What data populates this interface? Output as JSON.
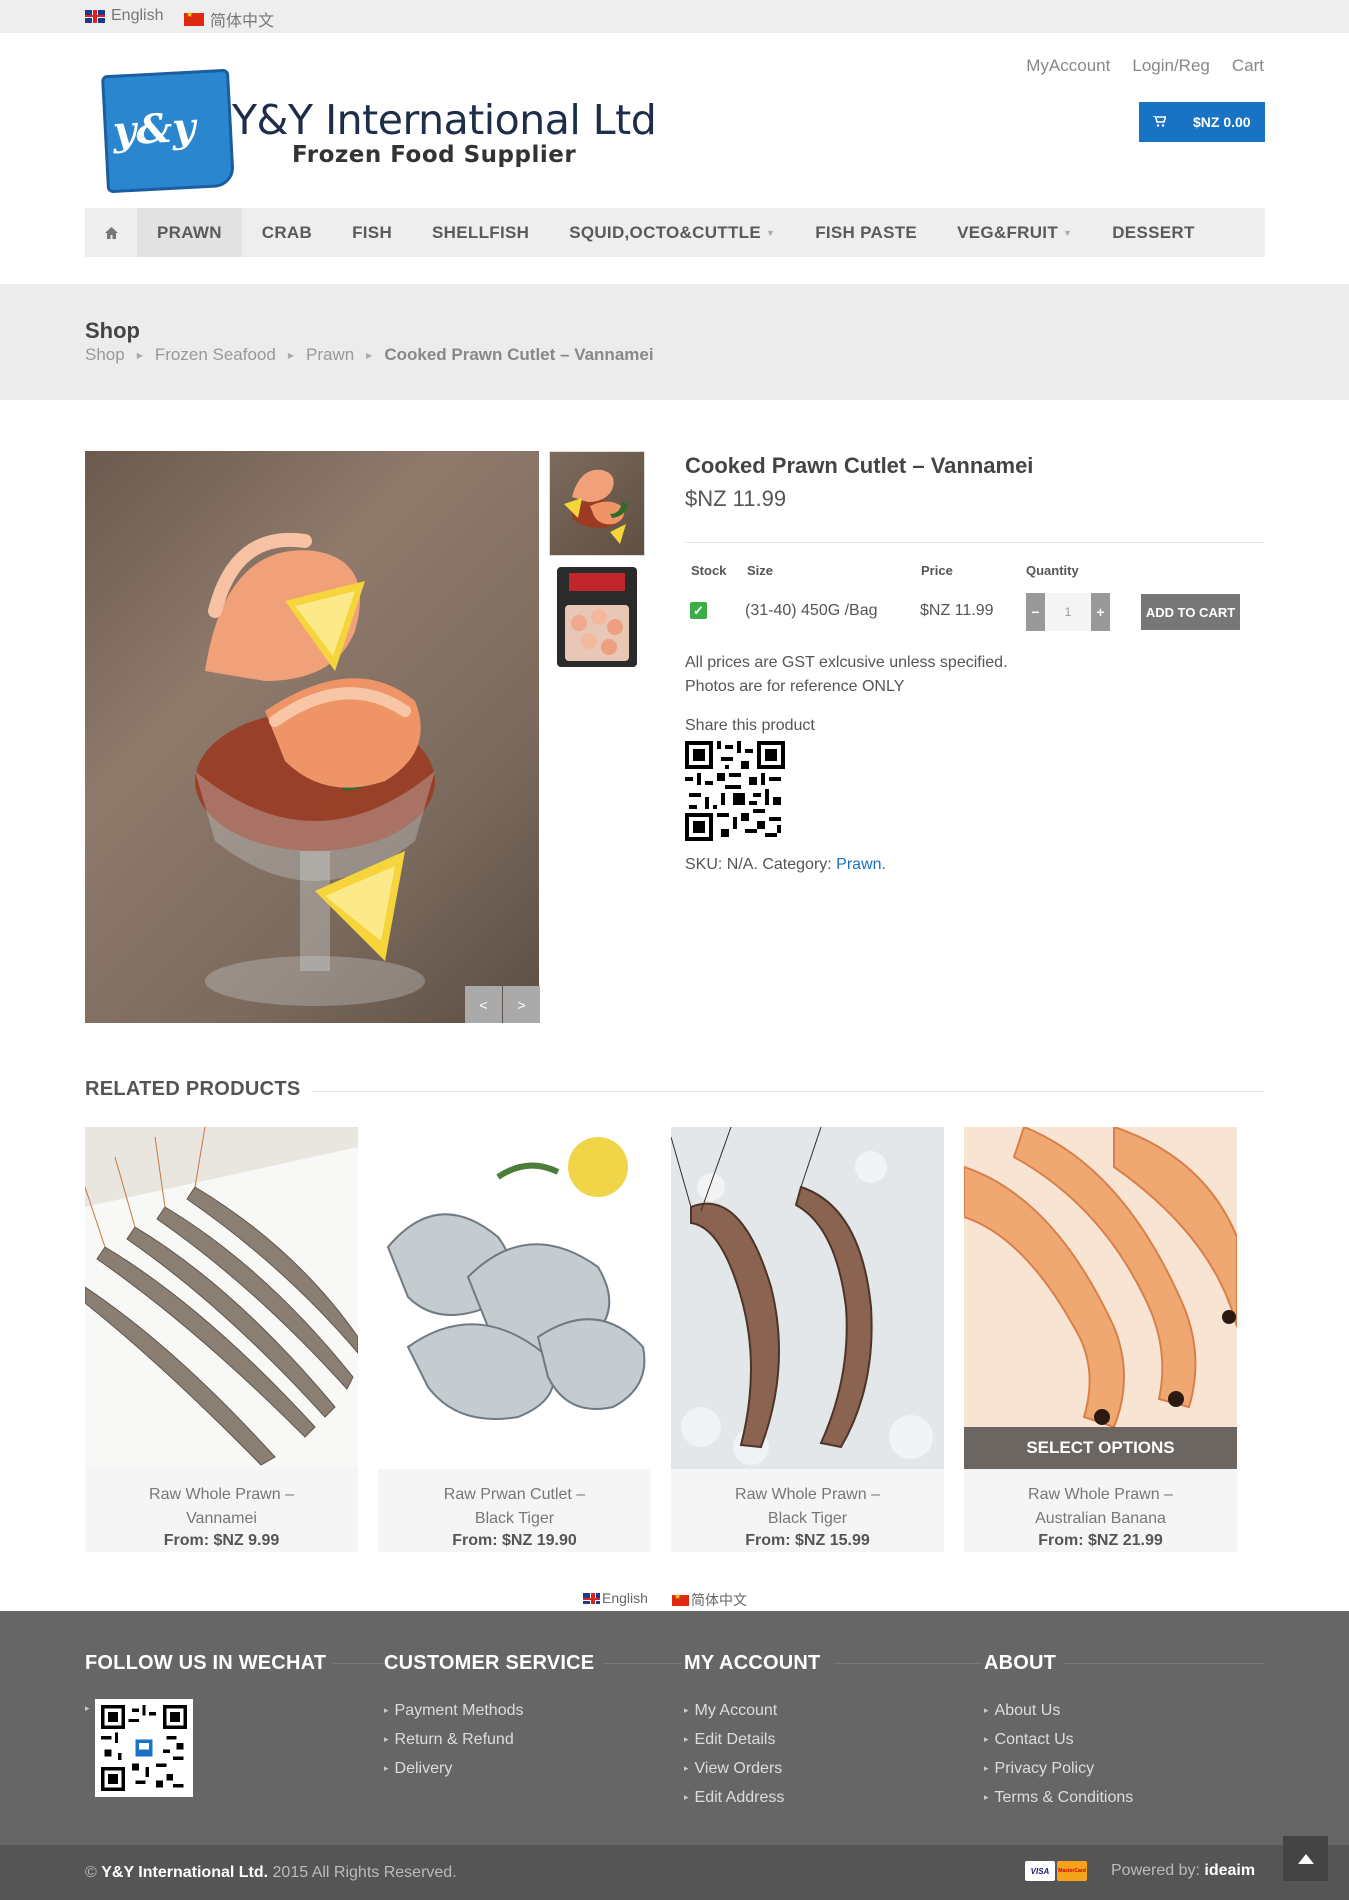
{
  "topbar": {
    "lang_en": "English",
    "lang_cn": "简体中文"
  },
  "header": {
    "logo_text": "y&y",
    "brand_name": "Y&Y International Ltd",
    "brand_tagline": "Frozen Food Supplier",
    "links": [
      "MyAccount",
      "Login/Reg",
      "Cart"
    ],
    "cart_total": "$NZ 0.00",
    "cart_icon": "cart-icon"
  },
  "nav": {
    "home_icon": "home-icon",
    "items": [
      "PRAWN",
      "CRAB",
      "FISH",
      "SHELLFISH",
      "SQUID,OCTO&CUTTLE",
      "FISH PASTE",
      "VEG&FRUIT",
      "DESSERT"
    ],
    "active": "PRAWN"
  },
  "page": {
    "title": "Shop",
    "breadcrumb": [
      "Shop",
      "Frozen Seafood",
      "Prawn",
      "Cooked Prawn Cutlet – Vannamei"
    ]
  },
  "product": {
    "title": "Cooked Prawn Cutlet – Vannamei",
    "price": "$NZ 11.99",
    "table_headers": {
      "stock": "Stock",
      "size": "Size",
      "price": "Price",
      "quantity": "Quantity"
    },
    "variant": {
      "size": "(31-40) 450G /Bag",
      "price": "$NZ 11.99",
      "quantity": "1",
      "in_stock": true
    },
    "add_to_cart": "ADD TO CART",
    "note_1": "All prices are GST exlcusive unless specified.",
    "note_2": "Photos are for reference ONLY",
    "share_label": "Share this product",
    "sku_text": "SKU: N/A. Category:",
    "category": "Prawn.",
    "image_prev": "<",
    "image_next": ">"
  },
  "related": {
    "heading": "RELATED PRODUCTS",
    "items": [
      {
        "name_1": "Raw Whole Prawn –",
        "name_2": "Vannamei",
        "price": "From: $NZ 9.99"
      },
      {
        "name_1": "Raw Prwan Cutlet –",
        "name_2": "Black Tiger",
        "price": "From: $NZ 19.90"
      },
      {
        "name_1": "Raw Whole Prawn –",
        "name_2": "Black Tiger",
        "price": "From: $NZ 15.99"
      },
      {
        "name_1": "Raw Whole Prawn –",
        "name_2": "Australian Banana",
        "price": "From: $NZ 21.99"
      }
    ],
    "select_options": "SELECT OPTIONS"
  },
  "footer": {
    "lang_en": "English",
    "lang_cn": "简体中文",
    "wechat_heading": "FOLLOW US IN WECHAT",
    "customer_heading": "CUSTOMER SERVICE",
    "customer_links": [
      "Payment Methods",
      "Return & Refund",
      "Delivery"
    ],
    "account_heading": "MY ACCOUNT",
    "account_links": [
      "My Account",
      "Edit Details",
      "View Orders",
      "Edit Address"
    ],
    "about_heading": "ABOUT",
    "about_links": [
      "About Us",
      "Contact Us",
      "Privacy Policy",
      "Terms & Conditions"
    ],
    "copyright_prefix": "©",
    "copyright_company": "Y&Y International Ltd.",
    "copyright_suffix": "2015 All Rights Reserved.",
    "card_visa": "VISA",
    "card_mc": "MasterCard",
    "powered_by": "Powered by:",
    "powered_brand": "ideaim"
  },
  "colors": {
    "accent_blue": "#1873c4",
    "footer_bg": "#666666",
    "nav_bg": "#eeeeee"
  }
}
